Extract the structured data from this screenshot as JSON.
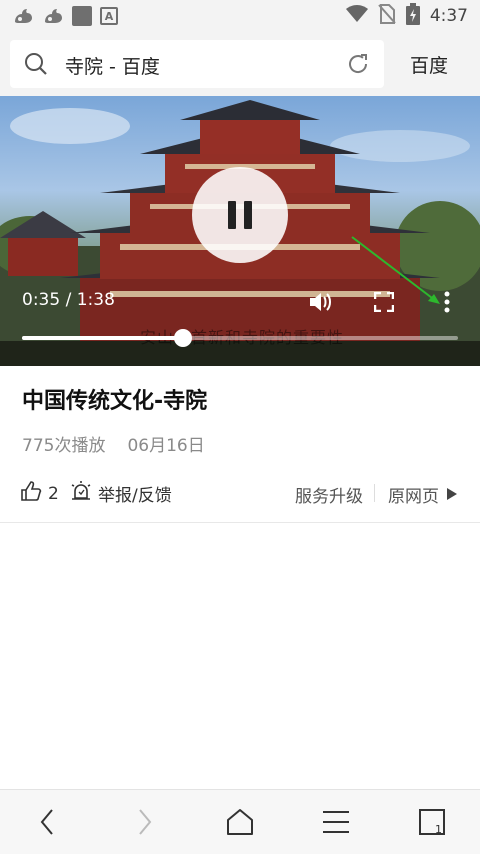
{
  "status_bar": {
    "time": "4:37",
    "icons": [
      "uc-browser-icon",
      "uc-browser-icon",
      "square-app-icon",
      "a-app-icon",
      "wifi-icon",
      "no-sim-icon",
      "battery-charging-icon"
    ]
  },
  "address_bar": {
    "query": "寺院 - 百度",
    "site_label": "百度"
  },
  "video": {
    "time_label": "0:35 / 1:38",
    "progress": 0.369,
    "subtitle": "安山、首新和寺院的重要性"
  },
  "info": {
    "title": "中国传统文化-寺院",
    "plays": "775次播放",
    "date": "06月16日"
  },
  "actions": {
    "like_count": "2",
    "report_label": "举报/反馈",
    "upgrade_label": "服务升级",
    "original_label": "原网页"
  },
  "bottom_nav": {
    "tab_count": "1"
  },
  "colors": {
    "annotation_arrow": "#2db82d"
  }
}
